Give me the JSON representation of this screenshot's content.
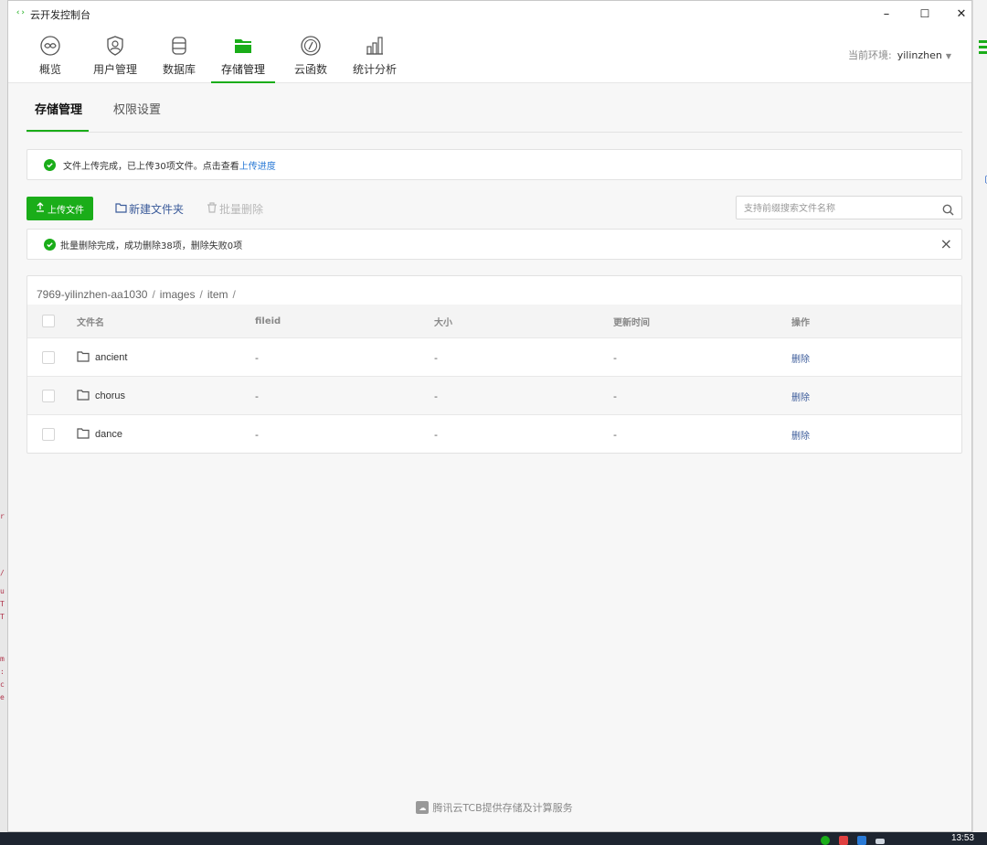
{
  "window": {
    "icon": "‹›",
    "title": "云开发控制台",
    "controls": {
      "minimize": "–",
      "maximize": "☐",
      "close": "✕"
    }
  },
  "nav": {
    "items": [
      {
        "label": "概览",
        "icon": "overview-icon"
      },
      {
        "label": "用户管理",
        "icon": "user-icon"
      },
      {
        "label": "数据库",
        "icon": "database-icon"
      },
      {
        "label": "存储管理",
        "icon": "folder-icon",
        "active": true
      },
      {
        "label": "云函数",
        "icon": "function-icon"
      },
      {
        "label": "统计分析",
        "icon": "stats-icon"
      }
    ],
    "env_label": "当前环境:",
    "env_value": "yilinzhen"
  },
  "subtabs": [
    "存储管理",
    "权限设置"
  ],
  "upload_alert": {
    "text": "文件上传完成，已上传30项文件。点击查看",
    "link": "上传进度"
  },
  "toolbar": {
    "upload": "上传文件",
    "new_folder": "新建文件夹",
    "batch_delete": "批量删除",
    "search_placeholder": "支持前缀搜索文件名称"
  },
  "delete_alert": {
    "text": "批量删除完成，成功删除38项，删除失败0项",
    "close": "×"
  },
  "breadcrumb": [
    "7969-yilinzhen-aa1030",
    "images",
    "item"
  ],
  "table": {
    "columns": [
      "文件名",
      "fileid",
      "大小",
      "更新时间",
      "操作"
    ],
    "rows": [
      {
        "name": "ancient",
        "fileid": "-",
        "size": "-",
        "updated": "-",
        "action": "删除"
      },
      {
        "name": "chorus",
        "fileid": "-",
        "size": "-",
        "updated": "-",
        "action": "删除"
      },
      {
        "name": "dance",
        "fileid": "-",
        "size": "-",
        "updated": "-",
        "action": "删除"
      }
    ]
  },
  "footer": "腾讯云TCB提供存储及计算服务",
  "taskbar": {
    "clock": "13:53"
  },
  "colors": {
    "accent": "#1aad19",
    "link": "#2a7ad6",
    "action": "#3b5b9a"
  }
}
